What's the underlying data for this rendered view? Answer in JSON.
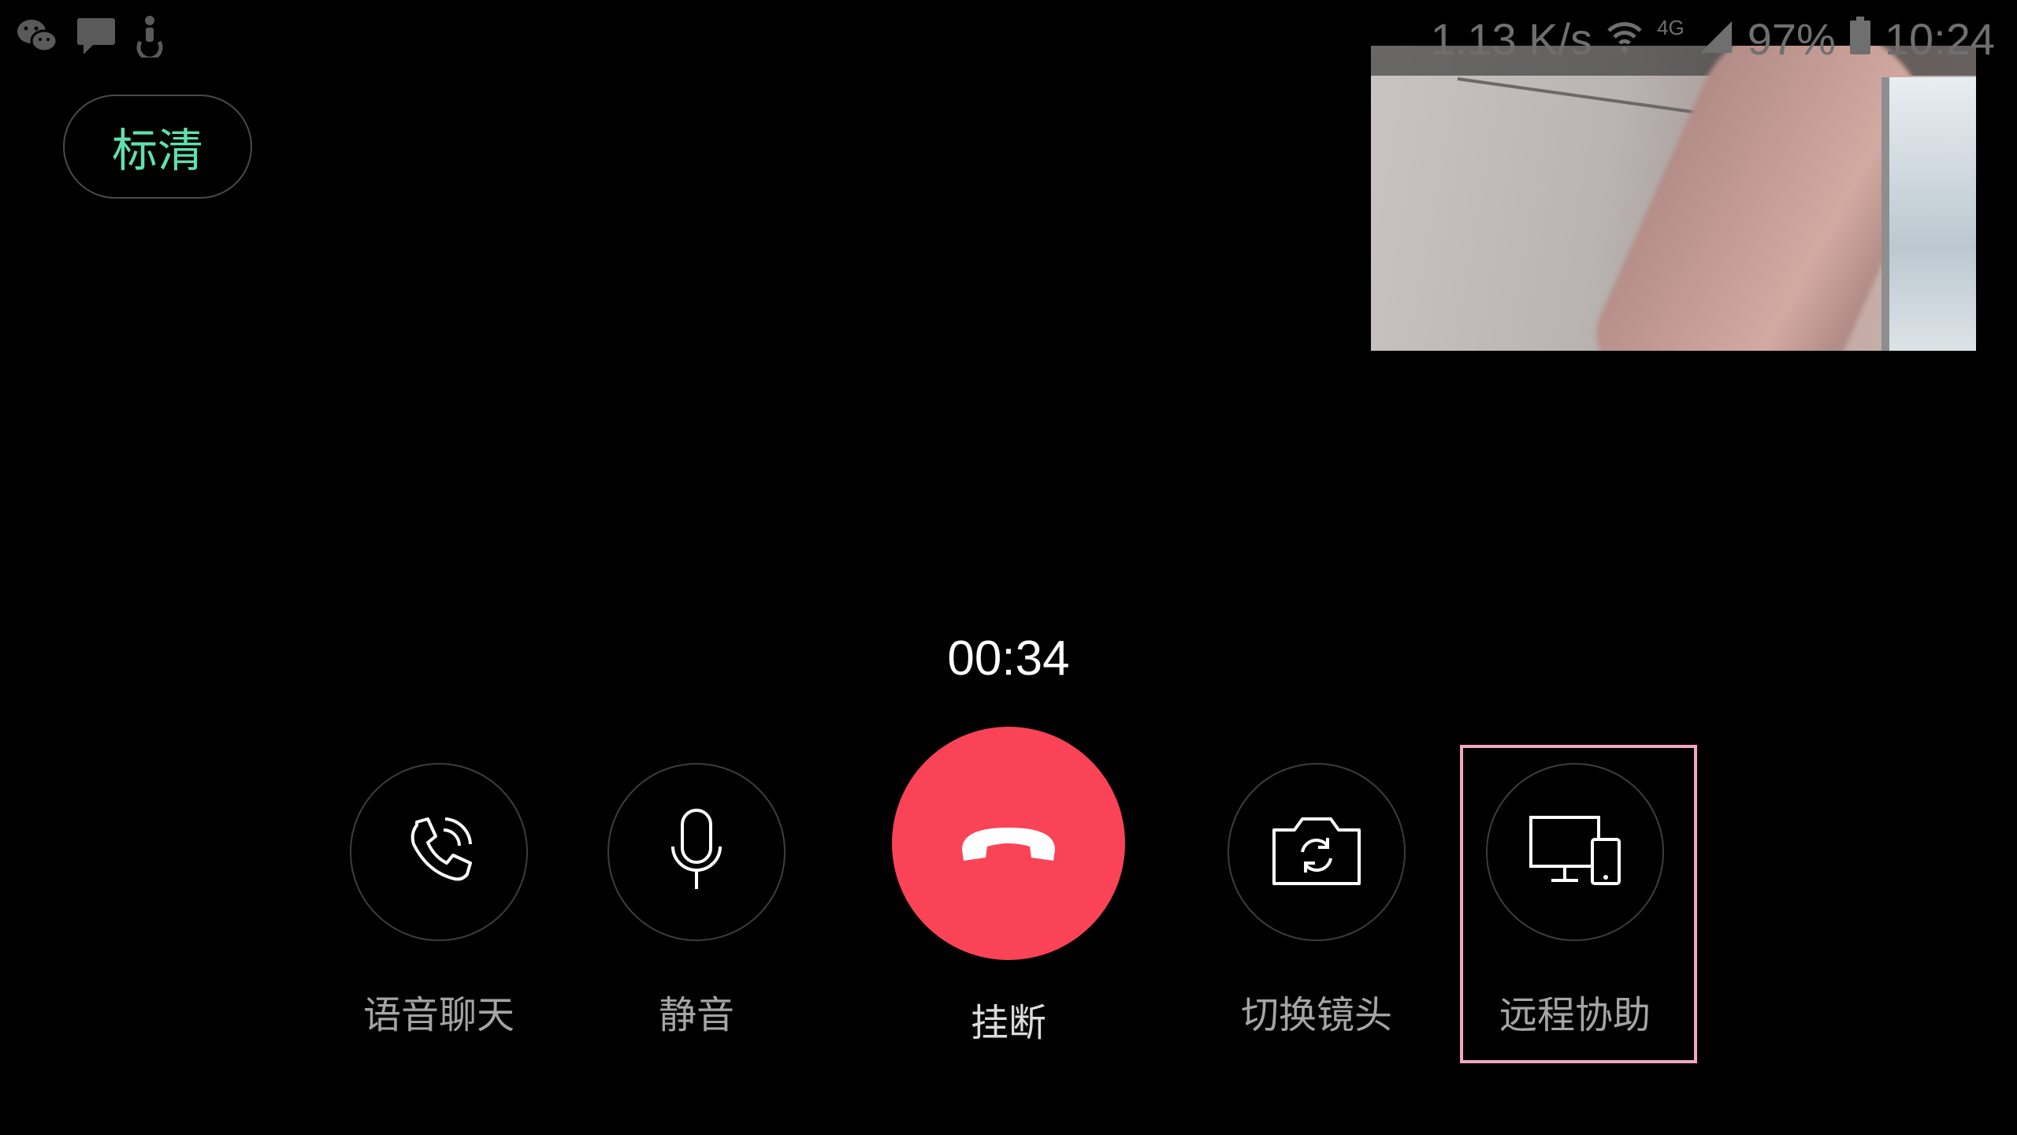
{
  "status_bar": {
    "icons_left": [
      "wechat-icon",
      "message-icon",
      "accessibility-icon"
    ],
    "network_speed": "1.13 K/s",
    "network_type": "4G",
    "battery_percent": "97%",
    "time": "10:24"
  },
  "quality": {
    "label": "标清",
    "color": "#5fe0b0"
  },
  "call": {
    "timer": "00:34"
  },
  "controls": {
    "voice_chat": "语音聊天",
    "mute": "静音",
    "hang_up": "挂断",
    "switch_camera": "切换镜头",
    "remote_assist": "远程协助"
  },
  "colors": {
    "hangup": "#fa4356",
    "highlight": "#f2a7c0"
  }
}
